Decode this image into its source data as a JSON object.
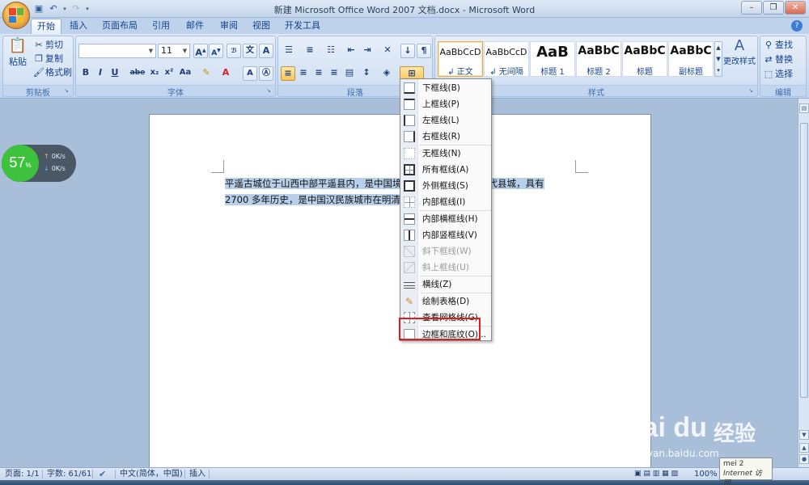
{
  "window": {
    "title": "新建 Microsoft Office Word 2007 文档.docx - Microsoft Word"
  },
  "tabs": [
    {
      "label": "开始",
      "active": true
    },
    {
      "label": "插入"
    },
    {
      "label": "页面布局"
    },
    {
      "label": "引用"
    },
    {
      "label": "邮件"
    },
    {
      "label": "审阅"
    },
    {
      "label": "视图"
    },
    {
      "label": "开发工具"
    }
  ],
  "clipboard": {
    "paste": "粘贴",
    "cut": "剪切",
    "copy": "复制",
    "format_painter": "格式刷",
    "label": "剪贴板"
  },
  "font": {
    "name": "",
    "size": "11",
    "label": "字体",
    "buttons": [
      "B",
      "I",
      "U",
      "abe",
      "x₂",
      "x²",
      "Aa"
    ]
  },
  "paragraph": {
    "label": "段落"
  },
  "styles": {
    "label": "样式",
    "items": [
      {
        "sample": "AaBbCcD",
        "name": "↲ 正文",
        "selected": true
      },
      {
        "sample": "AaBbCcD",
        "name": "↲ 无间隔"
      },
      {
        "sample": "AaB",
        "name": "标题 1"
      },
      {
        "sample": "AaBbC",
        "name": "标题 2"
      },
      {
        "sample": "AaBbC",
        "name": "标题"
      },
      {
        "sample": "AaBbC",
        "name": "副标题"
      }
    ],
    "change_styles": "更改样式"
  },
  "editing": {
    "label": "编辑",
    "find": "查找",
    "replace": "替换",
    "select": "选择"
  },
  "document": {
    "line1": "平遥古城位于山西中部平遥县内，是中国境",
    "line1_end": "全古代县城，具有",
    "line2": "2700 多年历史，是中国汉民族城市在明清时"
  },
  "network_widget": {
    "percent": "57",
    "percent_sign": "%",
    "up": "0K/s",
    "down": "0K/s"
  },
  "border_menu": {
    "items": [
      {
        "label": "下框线(B)",
        "icon": "bottom-border-icon"
      },
      {
        "label": "上框线(P)",
        "icon": "top-border-icon"
      },
      {
        "label": "左框线(L)",
        "icon": "left-border-icon"
      },
      {
        "label": "右框线(R)",
        "icon": "right-border-icon"
      },
      {
        "label": "无框线(N)",
        "icon": "no-border-icon"
      },
      {
        "label": "所有框线(A)",
        "icon": "all-borders-icon"
      },
      {
        "label": "外侧框线(S)",
        "icon": "outside-borders-icon"
      },
      {
        "label": "内部框线(I)",
        "icon": "inside-borders-icon"
      },
      {
        "label": "内部横框线(H)",
        "icon": "inside-horizontal-border-icon"
      },
      {
        "label": "内部竖框线(V)",
        "icon": "inside-vertical-border-icon"
      },
      {
        "label": "斜下框线(W)",
        "icon": "diagonal-down-border-icon",
        "disabled": true
      },
      {
        "label": "斜上框线(U)",
        "icon": "diagonal-up-border-icon",
        "disabled": true
      },
      {
        "label": "横线(Z)",
        "icon": "horizontal-line-icon"
      },
      {
        "label": "绘制表格(D)",
        "icon": "draw-table-icon"
      },
      {
        "label": "查看网格线(G)",
        "icon": "view-gridlines-icon"
      },
      {
        "label": "边框和底纹(O)...",
        "icon": "borders-shading-icon",
        "highlighted": true
      }
    ]
  },
  "status_bar": {
    "page": "页面: 1/1",
    "words": "字数: 61/61",
    "language": "中文(简体，中国)",
    "mode": "插入",
    "zoom": "100%"
  },
  "tooltip": {
    "line1": "mei 2",
    "line2": "Internet 访问"
  },
  "watermark": {
    "brand": "Bai du",
    "cn": "经验",
    "url": "jingyan.baidu.com"
  },
  "colors": {
    "highlight": "#b7cfe9",
    "annotation_red": "#e01c1c",
    "ribbon": "#dbe7f6",
    "accent": "#15428b"
  }
}
